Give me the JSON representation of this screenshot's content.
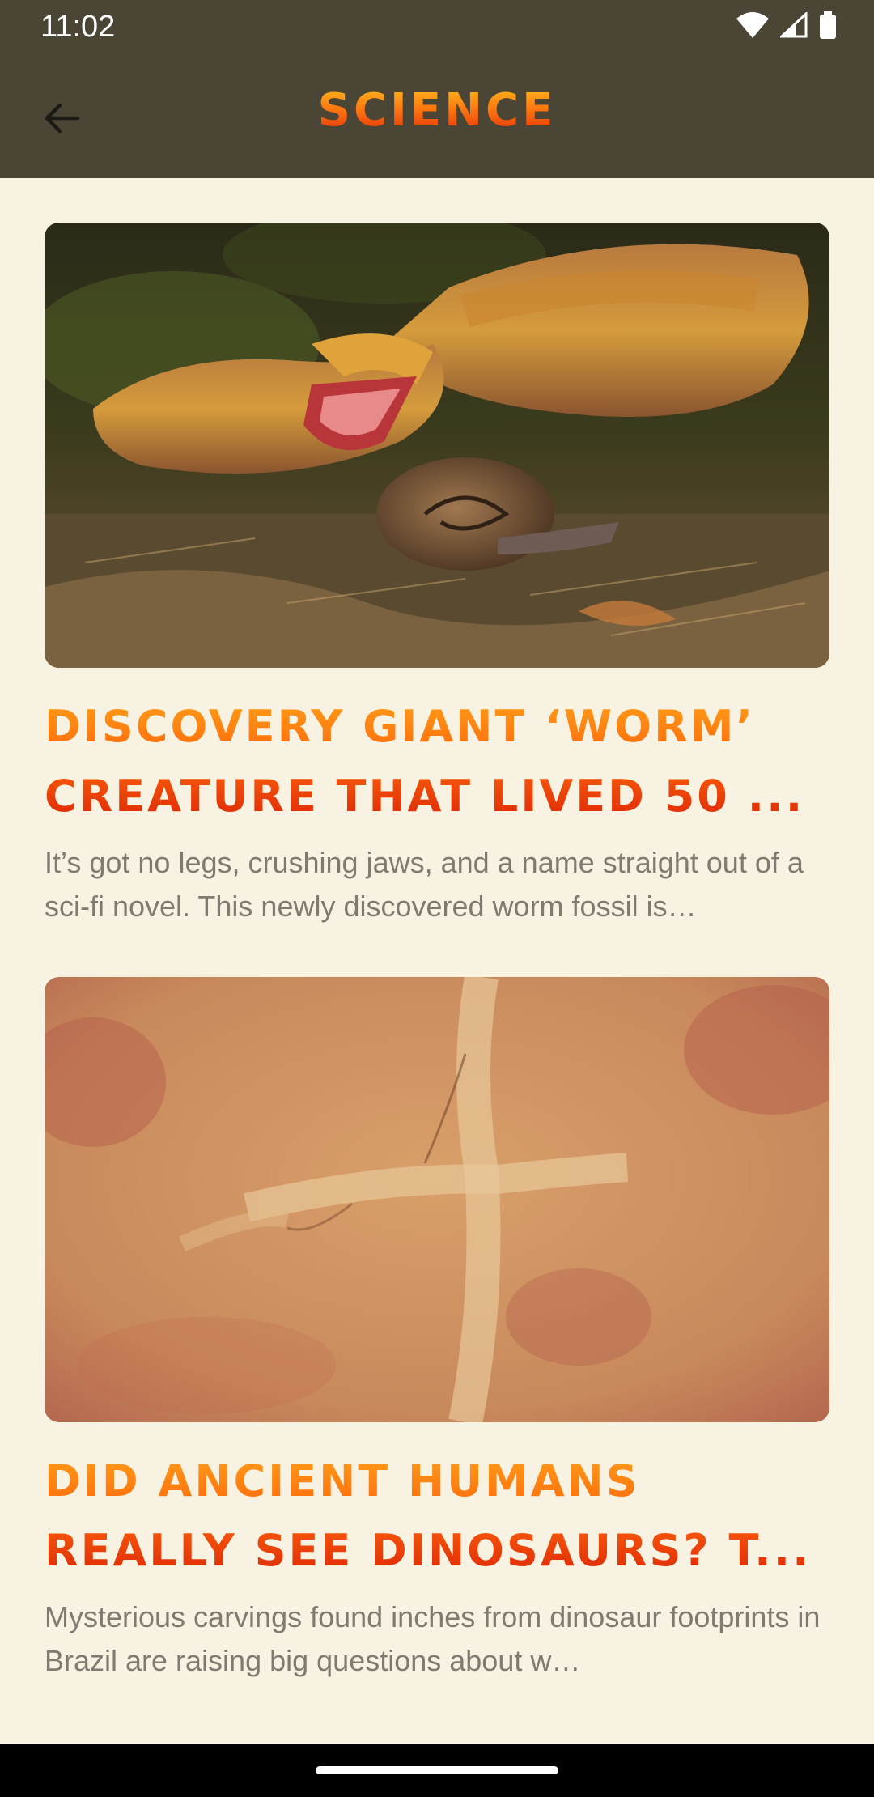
{
  "status_bar": {
    "time": "11:02"
  },
  "app_bar": {
    "title": "SCIENCE"
  },
  "articles": [
    {
      "title": "DISCOVERY GIANT ‘WORM’ CREATURE THAT LIVED 50 ...",
      "summary": "It’s got no legs, crushing jaws, and a name straight out of a sci-fi novel. This newly discovered worm fossil is…",
      "image": "worm-creature-eating-snail"
    },
    {
      "title": "DID ANCIENT HUMANS REALLY SEE DINOSAURS? T...",
      "summary": "Mysterious carvings found inches from dinosaur footprints in Brazil are raising big questions about w…",
      "image": "rock-carving-cross"
    }
  ],
  "colors": {
    "header": "#4a4534",
    "background": "#f8f2e2",
    "title_gradient_top": "#ffa41a",
    "title_gradient_bottom": "#d91e06"
  }
}
